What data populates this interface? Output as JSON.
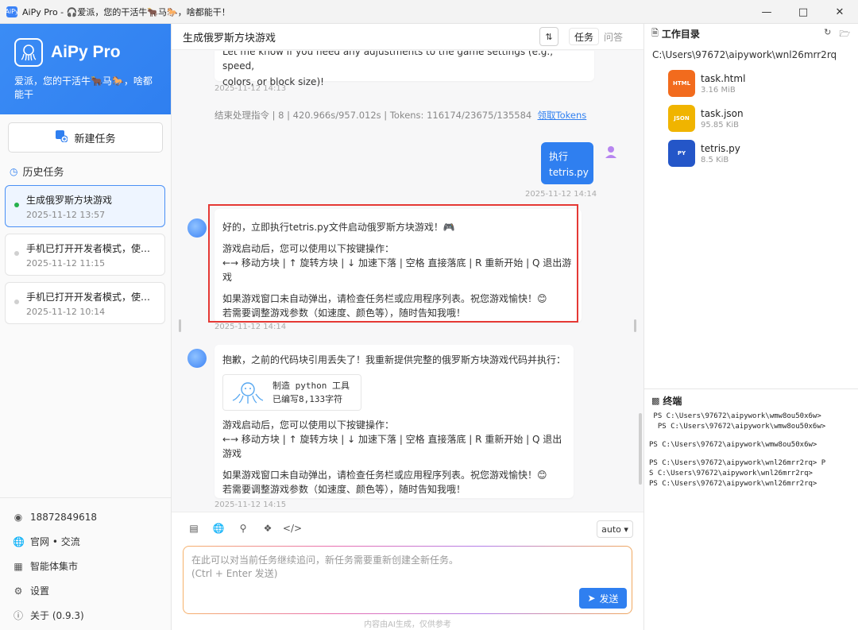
{
  "titlebar": {
    "title": "AiPy Pro - 🎧爱派，您的干活牛🐂马🐎，啥都能干！",
    "app_icon": "AiPy"
  },
  "sidebar": {
    "brand_name": "AiPy Pro",
    "slogan": "爱派，您的干活牛🐂马🐎，啥都能干",
    "new_task": "新建任务",
    "history_title": "历史任务",
    "tasks": [
      {
        "name": "生成俄罗斯方块游戏",
        "time": "2025-11-12 13:57"
      },
      {
        "name": "手机已打开开发者模式，使用...",
        "time": "2025-11-12 11:15"
      },
      {
        "name": "手机已打开开发者模式，使用...",
        "time": "2025-11-12 10:14"
      }
    ],
    "phone": "18872849618",
    "site": "官网 • 交流",
    "market": "智能体集市",
    "settings": "设置",
    "about": "关于 (0.9.3)"
  },
  "main": {
    "title": "生成俄罗斯方块游戏",
    "tab_task": "任务",
    "tab_qa": "问答",
    "msg1": {
      "line1": "Let me know if you need any adjustments to the game settings (e.g., speed,",
      "line2": "colors, or block size)!",
      "time": "2025-11-12 14:13"
    },
    "summary": "结束处理指令 | 8 | 420.966s/957.012s | Tokens: 116174/23675/135584",
    "summary_link": "领取Tokens",
    "user_msg": {
      "line1": "执行",
      "line2": "tetris.py",
      "time": "2025-11-12 14:14"
    },
    "msg2": {
      "p1": "好的，立即执行tetris.py文件启动俄罗斯方块游戏！🎮",
      "p2a": "游戏启动后，您可以使用以下按键操作：",
      "p2b": "←→ 移动方块 | ↑ 旋转方块 | ↓ 加速下落 | 空格 直接落底 | R 重新开始 | Q 退出游戏",
      "p3a": "如果游戏窗口未自动弹出，请检查任务栏或应用程序列表。祝您游戏愉快！😊",
      "p3b": "若需要调整游戏参数（如速度、颜色等），随时告知我哦！",
      "time": "2025-11-12 14:14"
    },
    "msg3": {
      "p1": "抱歉，之前的代码块引用丢失了！我重新提供完整的俄罗斯方块游戏代码并执行：",
      "tool_line1": "制造 python 工具",
      "tool_line2": "已编写8,133字符",
      "p2a": "游戏启动后，您可以使用以下按键操作：",
      "p2b": "←→ 移动方块 | ↑ 旋转方块 | ↓ 加速下落 | 空格 直接落底 | R 重新开始 | Q 退出游戏",
      "p3a": "如果游戏窗口未自动弹出，请检查任务栏或应用程序列表。祝您游戏愉快！😊",
      "p3b": "若需要调整游戏参数（如速度、颜色等），随时告知我哦！",
      "time": "2025-11-12 14:15"
    },
    "composer": {
      "mode": "auto ▾",
      "placeholder1": "在此可以对当前任务继续追问，新任务需要重新创建全新任务。",
      "placeholder2": "(Ctrl + Enter 发送)",
      "send": "发送",
      "footnote": "内容由AI生成，仅供参考"
    }
  },
  "workspace": {
    "title": "工作目录",
    "path": "C:\\Users\\97672\\aipywork\\wnl26mrr2rq",
    "files": [
      {
        "name": "task.html",
        "size": "3.16 MiB",
        "badge": "HTML",
        "color": "#f26b1d"
      },
      {
        "name": "task.json",
        "size": "95.85 KiB",
        "badge": "JSON",
        "color": "#f0b400"
      },
      {
        "name": "tetris.py",
        "size": "8.5 KiB",
        "badge": "PY",
        "color": "#2456c8"
      }
    ]
  },
  "terminal": {
    "title": "终端",
    "l1": " PS C:\\Users\\97672\\aipywork\\wmw8ou50x6w>",
    "l2": "  PS C:\\Users\\97672\\aipywork\\wmw8ou50x6w>",
    "l3": "PS C:\\Users\\97672\\aipywork\\wmw8ou50x6w>",
    "l4": "PS C:\\Users\\97672\\aipywork\\wnl26mrr2rq> P",
    "l5": "S C:\\Users\\97672\\aipywork\\wnl26mrr2rq>",
    "l6": "PS C:\\Users\\97672\\aipywork\\wnl26mrr2rq>"
  }
}
